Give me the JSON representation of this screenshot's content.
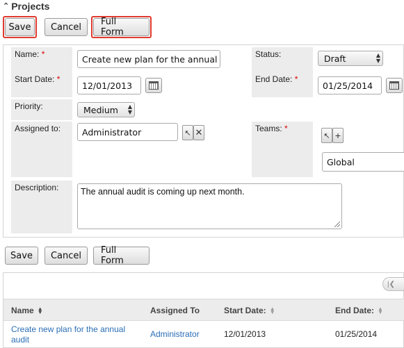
{
  "header": {
    "title": "Projects"
  },
  "buttons": {
    "save": "Save",
    "cancel": "Cancel",
    "full_form": "Full Form"
  },
  "form": {
    "name_label": "Name:",
    "name_value": "Create new plan for the annual a",
    "status_label": "Status:",
    "status_value": "Draft",
    "start_label": "Start Date:",
    "start_value": "12/01/2013",
    "end_label": "End Date:",
    "end_value": "01/25/2014",
    "priority_label": "Priority:",
    "priority_value": "Medium",
    "assigned_label": "Assigned to:",
    "assigned_value": "Administrator",
    "teams_label": "Teams:",
    "teams_value": "Global",
    "description_label": "Description:",
    "description_value": "The annual audit is coming up next month.",
    "required_marker": "*"
  },
  "list": {
    "columns": [
      "Name",
      "Assigned To",
      "Start Date:",
      "End Date:"
    ],
    "rows": [
      {
        "name": "Create new plan for the annual audit",
        "assigned": "Administrator",
        "start": "12/01/2013",
        "end": "01/25/2014"
      }
    ]
  },
  "icons": {
    "collapse": "chevron-up-icon",
    "calendar": "calendar-icon",
    "select": "select-arrow-icon",
    "clear": "clear-icon",
    "add": "add-icon",
    "sort": "sort-icon",
    "pager_first": "first-page-icon"
  },
  "colors": {
    "highlight": "#e03a2f",
    "link": "#2a6eb5",
    "label_bg": "#ececec",
    "required": "#d40000"
  }
}
